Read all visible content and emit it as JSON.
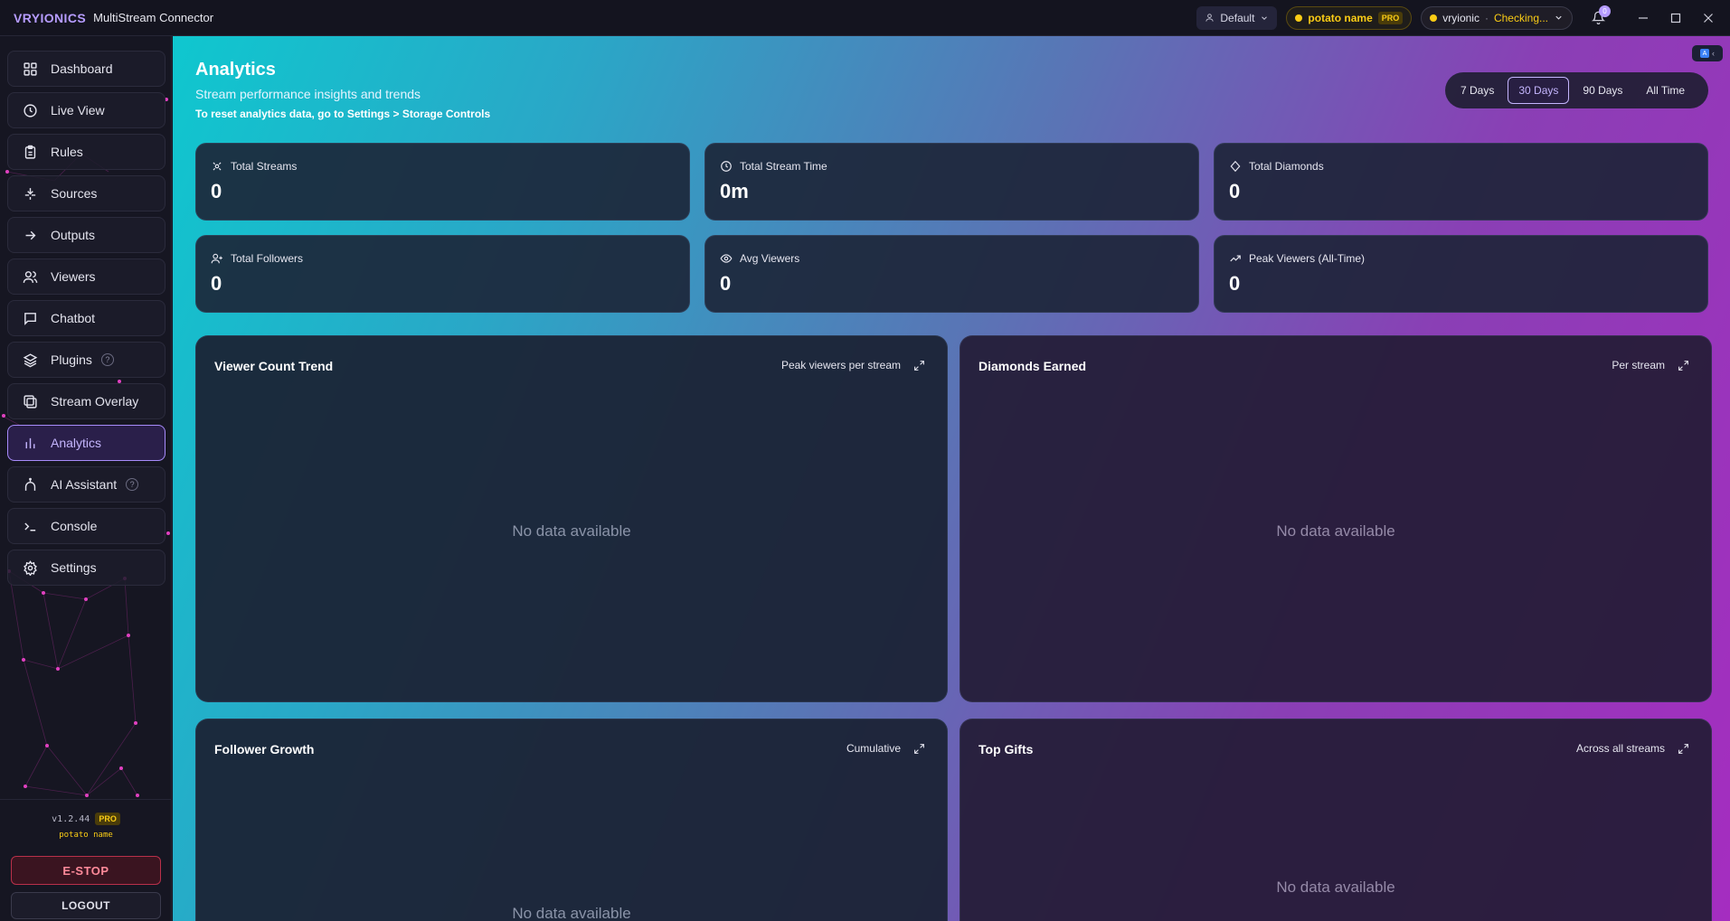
{
  "titlebar": {
    "logo": "VRYIONICS",
    "app_name": "MultiStream Connector",
    "profile": "Default",
    "user_name": "potato name",
    "user_tier": "PRO",
    "account": "vryionic",
    "separator": "·",
    "account_status": "Checking...",
    "notification_count": "0",
    "colors": {
      "accent": "#b69cff",
      "warning": "#facc15"
    }
  },
  "sidebar": {
    "items": [
      {
        "label": "Dashboard",
        "icon": "grid-icon"
      },
      {
        "label": "Live View",
        "icon": "clock-icon"
      },
      {
        "label": "Rules",
        "icon": "clipboard-icon"
      },
      {
        "label": "Sources",
        "icon": "input-icon"
      },
      {
        "label": "Outputs",
        "icon": "arrow-right-icon"
      },
      {
        "label": "Viewers",
        "icon": "users-icon"
      },
      {
        "label": "Chatbot",
        "icon": "chat-icon"
      },
      {
        "label": "Plugins",
        "icon": "layers-icon",
        "help": "?"
      },
      {
        "label": "Stream Overlay",
        "icon": "overlay-icon"
      },
      {
        "label": "Analytics",
        "icon": "bar-chart-icon",
        "active": true
      },
      {
        "label": "AI Assistant",
        "icon": "robot-icon",
        "help": "?"
      },
      {
        "label": "Console",
        "icon": "terminal-icon"
      },
      {
        "label": "Settings",
        "icon": "gear-icon"
      }
    ],
    "footer": {
      "version": "v1.2.44",
      "tier": "PRO",
      "user": "potato name",
      "estop": "E-STOP",
      "logout": "LOGOUT"
    }
  },
  "page": {
    "title": "Analytics",
    "subtitle": "Stream performance insights and trends",
    "note": "To reset analytics data, go to Settings > Storage Controls",
    "ranges": [
      "7 Days",
      "30 Days",
      "90 Days",
      "All Time"
    ],
    "selected_range": "30 Days"
  },
  "stats": [
    {
      "label": "Total Streams",
      "value": "0",
      "icon": "streams-icon"
    },
    {
      "label": "Total Stream Time",
      "value": "0m",
      "icon": "clock-icon"
    },
    {
      "label": "Total Diamonds",
      "value": "0",
      "icon": "diamond-icon"
    },
    {
      "label": "Total Followers",
      "value": "0",
      "icon": "user-plus-icon"
    },
    {
      "label": "Avg Viewers",
      "value": "0",
      "icon": "eye-icon"
    },
    {
      "label": "Peak Viewers (All-Time)",
      "value": "0",
      "icon": "trend-up-icon"
    }
  ],
  "panels": [
    {
      "title": "Viewer Count Trend",
      "meta": "Peak viewers per stream",
      "empty": "No data available"
    },
    {
      "title": "Diamonds Earned",
      "meta": "Per stream",
      "empty": "No data available"
    },
    {
      "title": "Follower Growth",
      "meta": "Cumulative",
      "empty": "No data available"
    },
    {
      "title": "Top Gifts",
      "meta": "Across all streams",
      "empty": "No data available"
    }
  ]
}
